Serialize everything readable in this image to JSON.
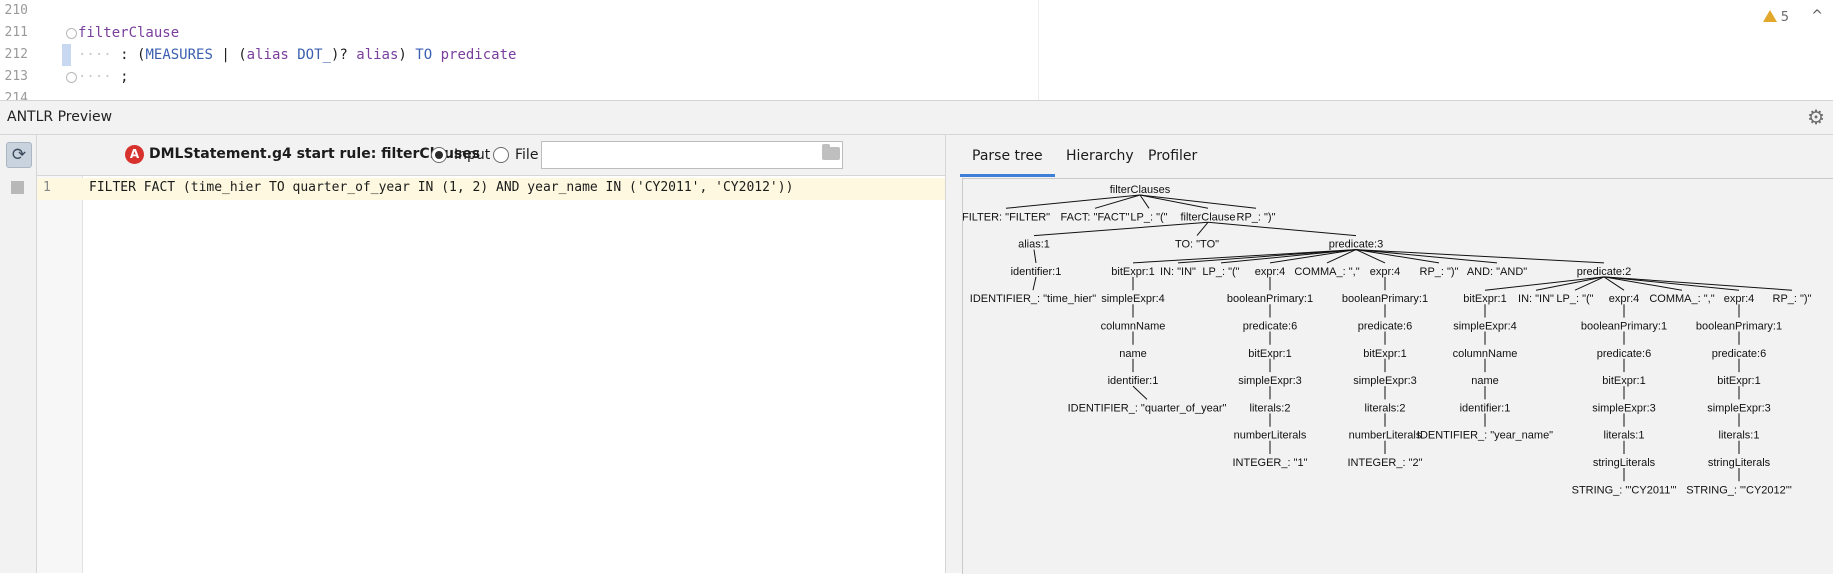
{
  "editor": {
    "lines": [
      {
        "number": "210",
        "text": ""
      },
      {
        "number": "211",
        "rule": "filterClause"
      },
      {
        "number": "212",
        "dots": "····",
        "colon": ":",
        "open1": "(",
        "t1": "MEASURES",
        "bar": "|",
        "open2": "(",
        "r1": "alias",
        "t2": "DOT_",
        "close_q": ")?",
        "r2": "alias",
        "close": ")",
        "t3": "TO",
        "r3": "predicate"
      },
      {
        "number": "213",
        "dots": "····",
        "semi": ";"
      },
      {
        "number": "214",
        "text": ""
      }
    ],
    "warning_count": "5",
    "collapse_glyph": "^"
  },
  "tool_window": {
    "title": "ANTLR Preview",
    "gear_glyph": "⚙"
  },
  "left_panel": {
    "refresh_glyph": "⟳",
    "grammar_icon_letter": "A",
    "grammar_label": "DMLStatement.g4 start rule: filterClauses",
    "radio_input": {
      "label": "Input",
      "selected": true
    },
    "radio_file": {
      "label": "File",
      "selected": false
    },
    "file_value": "",
    "input_line_number": "1",
    "input_text": "FILTER FACT (time_hier TO quarter_of_year IN (1, 2) AND year_name IN ('CY2011', 'CY2012'))"
  },
  "right_panel": {
    "tabs": [
      "Parse tree",
      "Hierarchy",
      "Profiler"
    ],
    "active_tab": "Parse tree"
  },
  "parse_tree": {
    "nodes": [
      {
        "id": "root",
        "label": "filterClauses"
      },
      {
        "id": "filter",
        "label": "FILTER: \"FILTER\"",
        "parent": "root"
      },
      {
        "id": "fact",
        "label": "FACT: \"FACT\"",
        "parent": "root"
      },
      {
        "id": "lp1",
        "label": "LP_: \"(\"",
        "parent": "root"
      },
      {
        "id": "fc",
        "label": "filterClause",
        "parent": "root"
      },
      {
        "id": "rp1",
        "label": "RP_: \")\"",
        "parent": "root"
      },
      {
        "id": "alias",
        "label": "alias:1",
        "parent": "fc"
      },
      {
        "id": "to",
        "label": "TO: \"TO\"",
        "parent": "fc"
      },
      {
        "id": "pred3",
        "label": "predicate:3",
        "parent": "fc"
      },
      {
        "id": "ident1",
        "label": "identifier:1",
        "parent": "alias"
      },
      {
        "id": "idtok1",
        "label": "IDENTIFIER_: \"time_hier\"",
        "parent": "ident1"
      },
      {
        "id": "bit1",
        "label": "bitExpr:1",
        "parent": "pred3"
      },
      {
        "id": "in1",
        "label": "IN: \"IN\"",
        "parent": "pred3"
      },
      {
        "id": "lp2",
        "label": "LP_: \"(\"",
        "parent": "pred3"
      },
      {
        "id": "e4a",
        "label": "expr:4",
        "parent": "pred3"
      },
      {
        "id": "c1",
        "label": "COMMA_: \",\"",
        "parent": "pred3"
      },
      {
        "id": "e4b",
        "label": "expr:4",
        "parent": "pred3"
      },
      {
        "id": "rp2",
        "label": "RP_: \")\"",
        "parent": "pred3"
      },
      {
        "id": "and",
        "label": "AND: \"AND\"",
        "parent": "pred3"
      },
      {
        "id": "pred2",
        "label": "predicate:2",
        "parent": "pred3"
      },
      {
        "id": "se1",
        "label": "simpleExpr:4",
        "parent": "bit1"
      },
      {
        "id": "cn1",
        "label": "columnName",
        "parent": "se1"
      },
      {
        "id": "nm1",
        "label": "name",
        "parent": "cn1"
      },
      {
        "id": "id2",
        "label": "identifier:1",
        "parent": "nm1"
      },
      {
        "id": "idtok2",
        "label": "IDENTIFIER_: \"quarter_of_year\"",
        "parent": "id2"
      },
      {
        "id": "bpA",
        "label": "booleanPrimary:1",
        "parent": "e4a"
      },
      {
        "id": "p6A",
        "label": "predicate:6",
        "parent": "bpA"
      },
      {
        "id": "bA",
        "label": "bitExpr:1",
        "parent": "p6A"
      },
      {
        "id": "sA",
        "label": "simpleExpr:3",
        "parent": "bA"
      },
      {
        "id": "lA",
        "label": "literals:2",
        "parent": "sA"
      },
      {
        "id": "nA",
        "label": "numberLiterals",
        "parent": "lA"
      },
      {
        "id": "iA",
        "label": "INTEGER_: \"1\"",
        "parent": "nA"
      },
      {
        "id": "bpB",
        "label": "booleanPrimary:1",
        "parent": "e4b"
      },
      {
        "id": "p6B",
        "label": "predicate:6",
        "parent": "bpB"
      },
      {
        "id": "bB",
        "label": "bitExpr:1",
        "parent": "p6B"
      },
      {
        "id": "sB",
        "label": "simpleExpr:3",
        "parent": "bB"
      },
      {
        "id": "lB",
        "label": "literals:2",
        "parent": "sB"
      },
      {
        "id": "nB",
        "label": "numberLiterals",
        "parent": "lB"
      },
      {
        "id": "iB",
        "label": "INTEGER_: \"2\"",
        "parent": "nB"
      },
      {
        "id": "bit2",
        "label": "bitExpr:1",
        "parent": "pred2"
      },
      {
        "id": "in2",
        "label": "IN: \"IN\"",
        "parent": "pred2"
      },
      {
        "id": "lp3",
        "label": "LP_: \"(\"",
        "parent": "pred2"
      },
      {
        "id": "e4c",
        "label": "expr:4",
        "parent": "pred2"
      },
      {
        "id": "c2",
        "label": "COMMA_: \",\"",
        "parent": "pred2"
      },
      {
        "id": "e4d",
        "label": "expr:4",
        "parent": "pred2"
      },
      {
        "id": "rp3",
        "label": "RP_: \")\"",
        "parent": "pred2"
      },
      {
        "id": "se2",
        "label": "simpleExpr:4",
        "parent": "bit2"
      },
      {
        "id": "cn2",
        "label": "columnName",
        "parent": "se2"
      },
      {
        "id": "nm2",
        "label": "name",
        "parent": "cn2"
      },
      {
        "id": "id3",
        "label": "identifier:1",
        "parent": "nm2"
      },
      {
        "id": "idtok3",
        "label": "IDENTIFIER_: \"year_name\"",
        "parent": "id3"
      },
      {
        "id": "bpC",
        "label": "booleanPrimary:1",
        "parent": "e4c"
      },
      {
        "id": "p6C",
        "label": "predicate:6",
        "parent": "bpC"
      },
      {
        "id": "bC",
        "label": "bitExpr:1",
        "parent": "p6C"
      },
      {
        "id": "sC",
        "label": "simpleExpr:3",
        "parent": "bC"
      },
      {
        "id": "lC",
        "label": "literals:1",
        "parent": "sC"
      },
      {
        "id": "slC",
        "label": "stringLiterals",
        "parent": "lC"
      },
      {
        "id": "stC",
        "label": "STRING_: \"'CY2011'\"",
        "parent": "slC"
      },
      {
        "id": "bpD",
        "label": "booleanPrimary:1",
        "parent": "e4d"
      },
      {
        "id": "p6D",
        "label": "predicate:6",
        "parent": "bpD"
      },
      {
        "id": "bD",
        "label": "bitExpr:1",
        "parent": "p6D"
      },
      {
        "id": "sD",
        "label": "simpleExpr:3",
        "parent": "bD"
      },
      {
        "id": "lD",
        "label": "literals:1",
        "parent": "sD"
      },
      {
        "id": "slD",
        "label": "stringLiterals",
        "parent": "lD"
      },
      {
        "id": "stD",
        "label": "STRING_: \"'CY2012'\"",
        "parent": "slD"
      }
    ]
  }
}
